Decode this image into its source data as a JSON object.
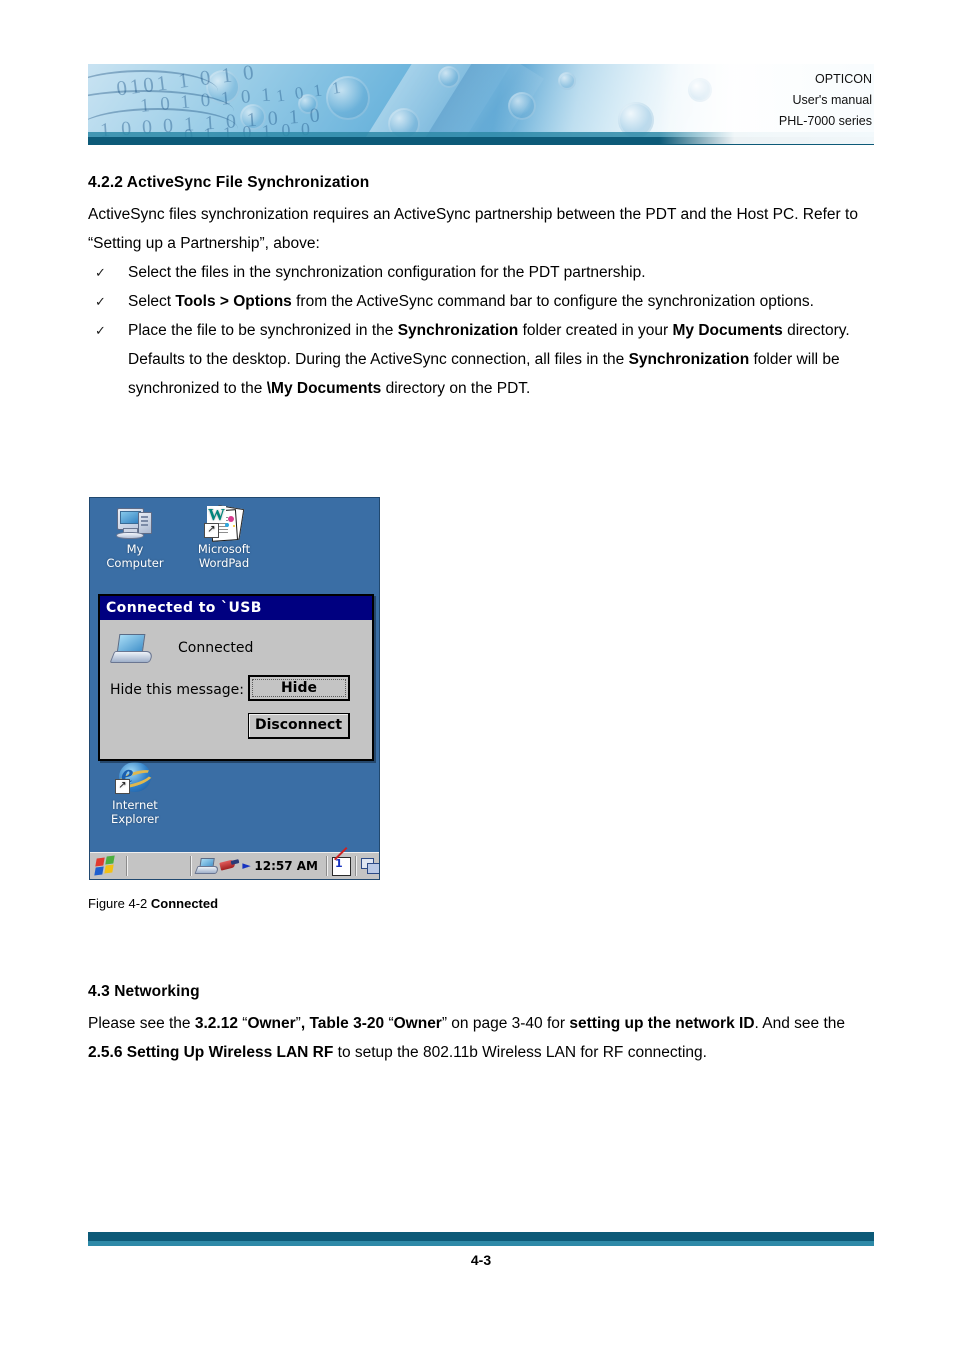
{
  "header": {
    "brand": "OPTICON",
    "doc_type": "User's manual",
    "product": "PHL-7000 series",
    "accent_deep": "#0d5a78",
    "accent_mid": "#2e8aa8"
  },
  "section_422": {
    "heading": "4.2.2 ActiveSync File Synchronization",
    "intro": "ActiveSync files synchronization requires an ActiveSync partnership between the PDT and the Host PC. Refer to “Setting up a Partnership”, above:",
    "bullet_marker": "✓",
    "bullets": [
      {
        "parts": [
          {
            "text": "Select the files in the synchronization configuration for the PDT partnership.",
            "bold": false
          }
        ]
      },
      {
        "parts": [
          {
            "text": "Select ",
            "bold": false
          },
          {
            "text": "Tools > Options",
            "bold": true
          },
          {
            "text": " from the ActiveSync command bar to configure the synchronization options.",
            "bold": false
          }
        ]
      },
      {
        "parts": [
          {
            "text": "Place the file to be synchronized in the ",
            "bold": false
          },
          {
            "text": "Synchronization",
            "bold": true
          },
          {
            "text": " folder created in your ",
            "bold": false
          },
          {
            "text": "My Documents",
            "bold": true
          },
          {
            "text": " directory. Defaults to the desktop. During the ActiveSync connection, all files in the ",
            "bold": false
          },
          {
            "text": "Synchronization",
            "bold": true
          },
          {
            "text": " folder will be synchronized to the ",
            "bold": false
          },
          {
            "text": "\\My Documents",
            "bold": true
          },
          {
            "text": " directory on the PDT.",
            "bold": false
          }
        ]
      }
    ]
  },
  "figure": {
    "caption_prefix": "Figure 4-2 ",
    "caption_bold": "Connected",
    "screenshot": {
      "desktop_background": "#3a6ea5",
      "icons": [
        {
          "name": "my-computer",
          "label_line1": "My",
          "label_line2": "Computer"
        },
        {
          "name": "microsoft-wordpad",
          "label_line1": "Microsoft",
          "label_line2": "WordPad"
        },
        {
          "name": "internet-explorer",
          "label_line1": "Internet",
          "label_line2": "Explorer"
        }
      ],
      "dialog": {
        "title": "Connected to `USB",
        "titlebar_color": "#000080",
        "status_text": "Connected",
        "hide_label": "Hide this message:",
        "buttons": [
          {
            "name": "hide",
            "label": "Hide"
          },
          {
            "name": "disconnect",
            "label": "Disconnect"
          }
        ]
      },
      "taskbar": {
        "time": "12:57 AM",
        "tray_items": [
          "connection-laptop-icon",
          "plug-icon",
          "arrow-icon",
          "clock-time",
          "notes-icon",
          "windows-stack-icon"
        ]
      }
    }
  },
  "section_43": {
    "heading": "4.3 Networking",
    "parts": [
      {
        "text": "Please see the ",
        "bold": false
      },
      {
        "text": "3.2.12 ",
        "bold": true
      },
      {
        "text": "“",
        "bold": false
      },
      {
        "text": "Owner",
        "bold": true
      },
      {
        "text": "”",
        "bold": false
      },
      {
        "text": ", Table 3-20 ",
        "bold": true
      },
      {
        "text": "“",
        "bold": false
      },
      {
        "text": "Owner",
        "bold": true
      },
      {
        "text": "” on page 3-40 for ",
        "bold": false
      },
      {
        "text": "setting up the network ID",
        "bold": true
      },
      {
        "text": ". And see the ",
        "bold": false
      },
      {
        "text": "2.5.6 Setting Up Wireless LAN RF",
        "bold": true
      },
      {
        "text": " to setup the 802.11b Wireless LAN for RF connecting.",
        "bold": false
      }
    ]
  },
  "footer": {
    "page_number": "4-3"
  }
}
